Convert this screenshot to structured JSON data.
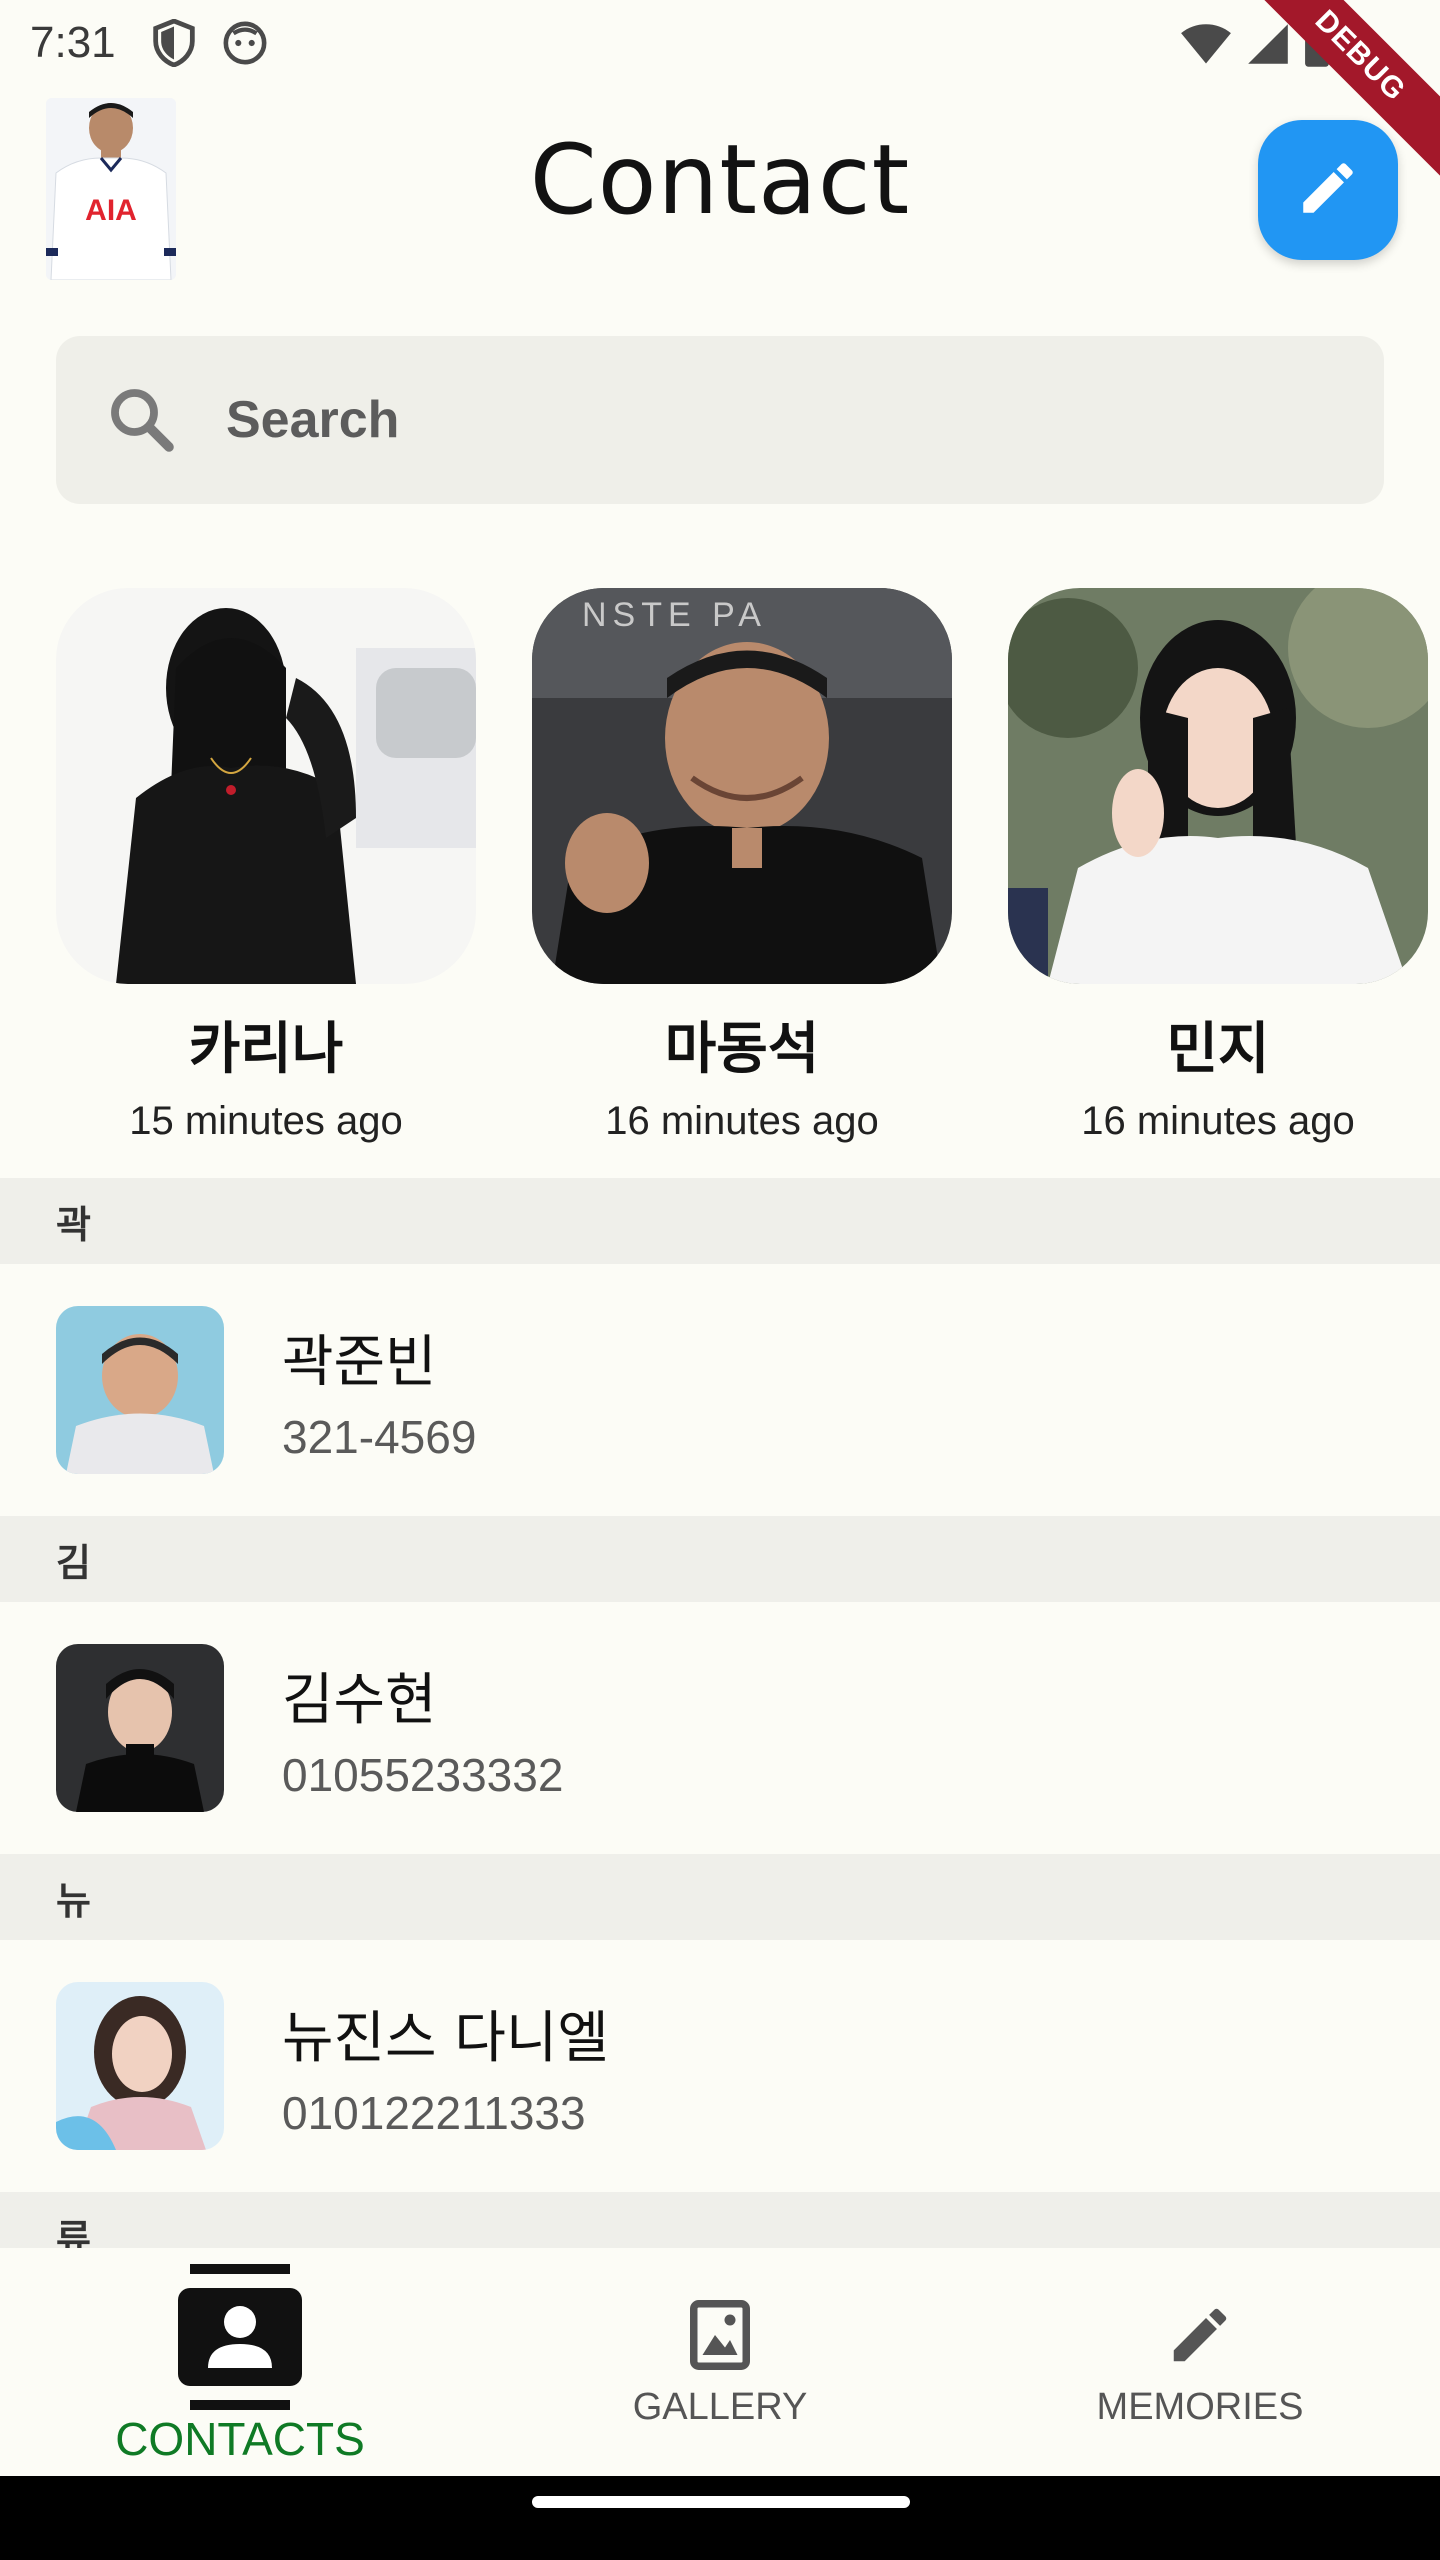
{
  "status_bar": {
    "time": "7:31",
    "debug_label": "DEBUG"
  },
  "header": {
    "title": "Contact"
  },
  "search": {
    "placeholder": "Search"
  },
  "favorites": [
    {
      "name": "카리나",
      "time": "15 minutes ago"
    },
    {
      "name": "마동석",
      "time": "16 minutes ago"
    },
    {
      "name": "민지",
      "time": "16 minutes ago"
    }
  ],
  "sections": [
    {
      "header": "곽",
      "contacts": [
        {
          "name": "곽준빈",
          "phone": "321-4569"
        }
      ]
    },
    {
      "header": "김",
      "contacts": [
        {
          "name": "김수현",
          "phone": "01055233332"
        }
      ]
    },
    {
      "header": "뉴",
      "contacts": [
        {
          "name": "뉴진스 다니엘",
          "phone": "010122211333"
        }
      ]
    },
    {
      "header": "류"
    }
  ],
  "nav": {
    "items": [
      {
        "label": "CONTACTS",
        "active": true
      },
      {
        "label": "GALLERY",
        "active": false
      },
      {
        "label": "MEMORIES",
        "active": false
      }
    ]
  },
  "colors": {
    "background": "#fcfcf6",
    "fab": "#2196f3",
    "nav_active": "#0f7a25",
    "debug_banner": "#a3182a",
    "section_bg": "#efefea"
  }
}
